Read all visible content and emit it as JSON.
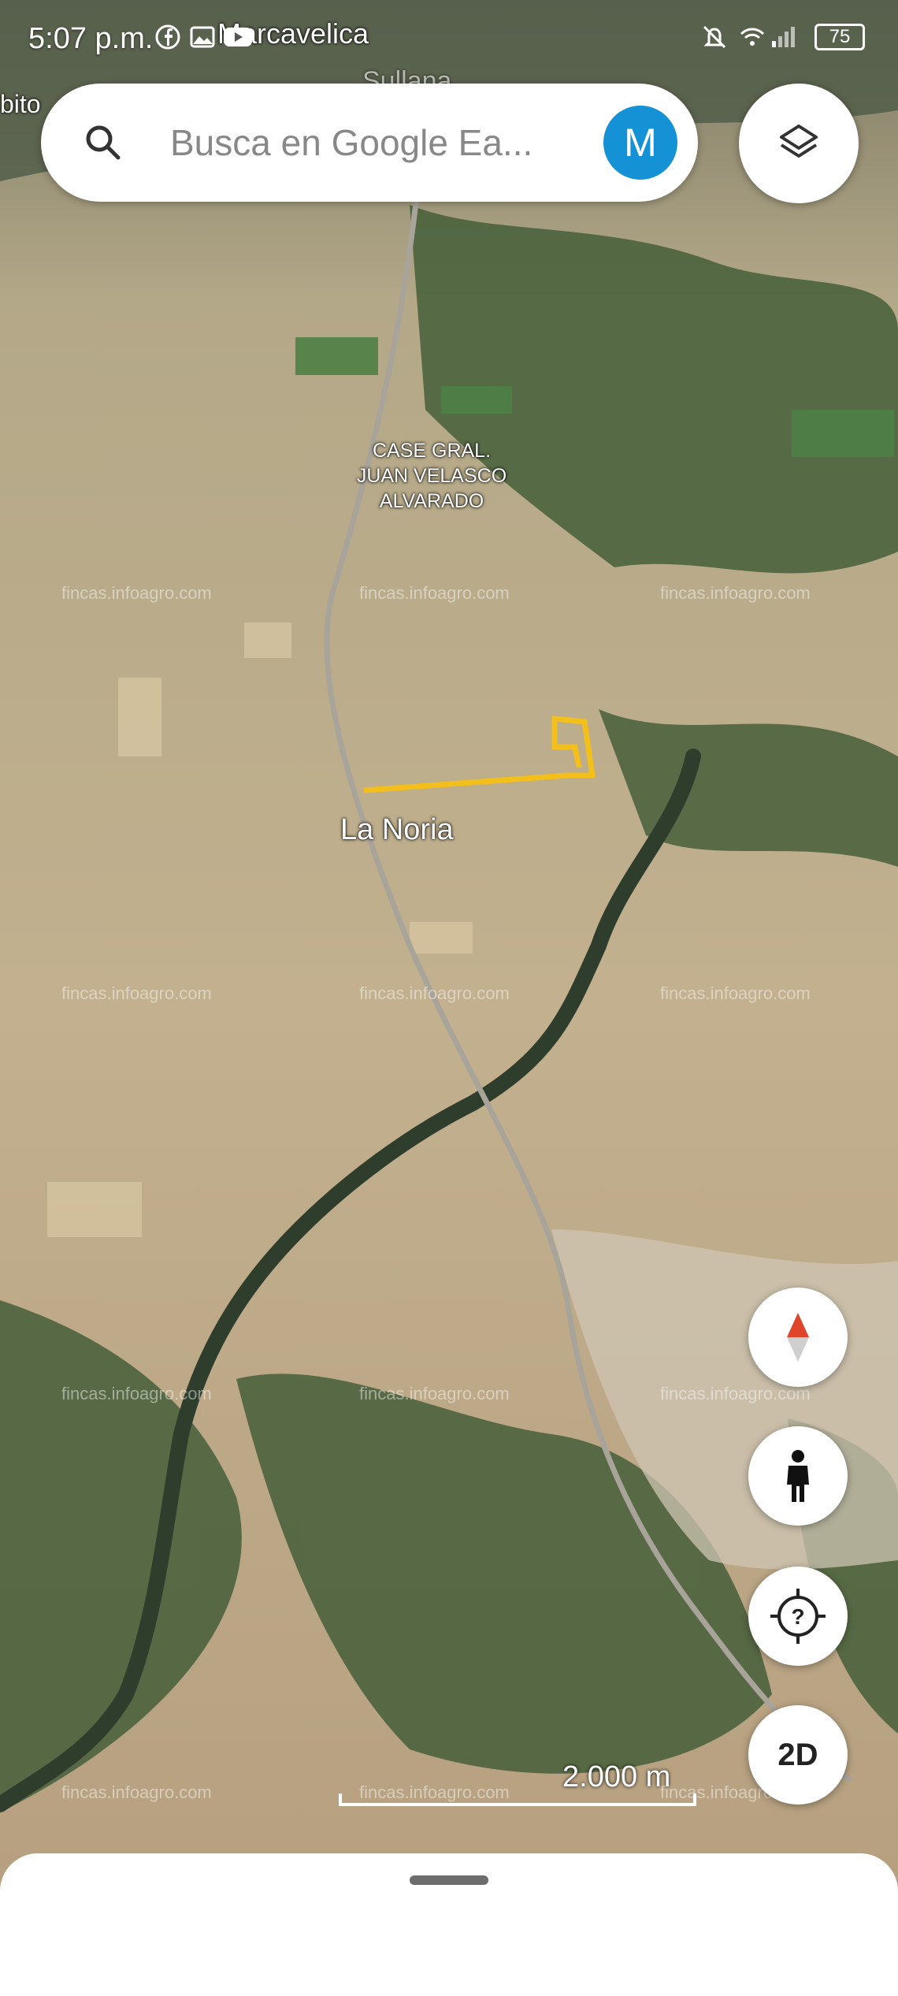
{
  "status_bar": {
    "time": "5:07 p.m.",
    "battery": "75",
    "icons": [
      "facebook-icon",
      "gallery-icon",
      "youtube-icon",
      "mute-icon",
      "wifi-icon",
      "signal-icon"
    ]
  },
  "search": {
    "placeholder": "Busca en Google Ea...",
    "avatar_letter": "M",
    "avatar_color": "#1592d6"
  },
  "map": {
    "place_labels": {
      "top_place": "Marcavelica",
      "left_place": "bito",
      "partial_top": "Sullana",
      "settlement": "CASE GRAL.\nJUAN VELASCO\nALVARADO",
      "town": "La Noria"
    },
    "watermark": "fincas.infoagro.com",
    "plot_outline_color": "#f2bf1b",
    "scale_label": "2.000 m"
  },
  "controls": {
    "layers": "layers-icon",
    "compass": "compass-icon",
    "street_view": "pegman-icon",
    "voyager": "help-location-icon",
    "view_mode": "2D"
  }
}
